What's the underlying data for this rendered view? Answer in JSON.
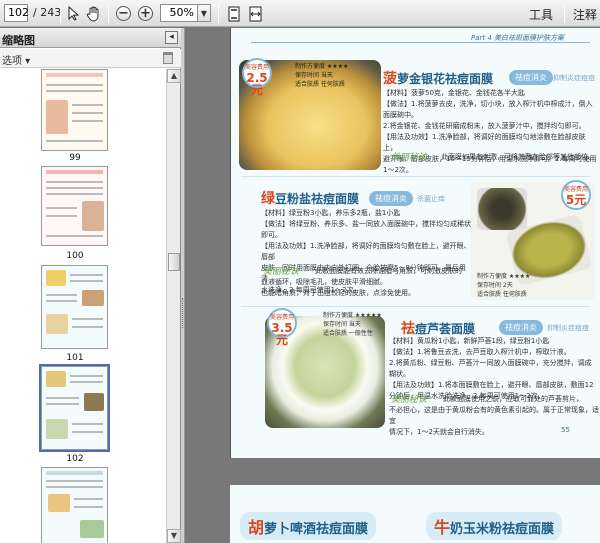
{
  "toolbar": {
    "page_current": "102",
    "page_total": "/ 243",
    "zoom": "50%",
    "tools_label": "工具",
    "comment_label": "注释",
    "icons": [
      "select-arrow-icon",
      "hand-icon",
      "zoom-out-icon",
      "zoom-in-icon",
      "fit-page-icon",
      "fit-width-icon"
    ]
  },
  "sidebar": {
    "title": "缩略图",
    "options_label": "选项 ▾",
    "thumbnails": [
      {
        "label": "99"
      },
      {
        "label": "100"
      },
      {
        "label": "101"
      },
      {
        "label": "102"
      }
    ]
  },
  "document": {
    "header": "Part 4 美白祛斑面膜护肤方案",
    "page_number": "55",
    "recipes": [
      {
        "price_label": "美容费用",
        "price": "2.5元",
        "specs": [
          "制作方便度 ★★★★",
          "保存时间 当天",
          "适合肤质 任何肤质"
        ],
        "title_lead": "菠",
        "title_rest": "萝金银花祛痘面膜",
        "badge": "祛痘消炎",
        "note": "抑制炎症痘痘",
        "lines": [
          "【材料】菠萝50克，金银花、金钱花各半大匙",
          "【做法】1.将菠萝去皮，洗净，切小块，放入榨汁机中榨成汁，倒入面膜碗中。",
          "2.将金银花、金钱花研磨成粉末，放入菠萝汁中，搅拌均匀即可。",
          "【用法及功效】1.洗净脸部，将调好的面膜均匀地涂敷在脸部皮肤上，",
          "避开眼、唇部皮肤，10～15分钟后，用温水洗净即可。2.每周可使用",
          "1～2次。"
        ],
        "sig": "美丽秘诀",
        "tip": "此面膜如果有刺激，可将其敷在脸部等其他部位。"
      },
      {
        "price_label": "美容费用",
        "price": "5元",
        "specs": [
          "制作方便度 ★★★★",
          "保存时间 2天",
          "适合肤质 任何肤质"
        ],
        "title_lead": "绿",
        "title_rest": "豆粉盐祛痘面膜",
        "badge": "祛痘消炎",
        "note": "杀菌止痒",
        "lines": [
          "【材料】绿豆粉3小匙，养乐多2瓶，盐1小匙",
          "【做法】将绿豆粉、养乐多、盐一同放入面膜碗中，搅拌均匀成稀状即可。",
          "【用法及功效】1.洗净脸部，将调好的面膜均匀敷在脸上，避开眼、唇部",
          "皮肤，同时用面膜由内向外打圈，全脸按摩5～8分钟即可，最后用清",
          "水洗净。2.每周可使用1～2次。",
          "此敷面膜能有效去除油脂与角质，可刺激皮肤的",
          "血液循环，吸除毛孔，使皮肤平滑细腻。",
          "也能暗角质，对于出痘较轻的皮肤，点涂免使用。"
        ],
        "sig": "美丽秘诀"
      },
      {
        "price_label": "美容费用",
        "price": "3.5元",
        "specs": [
          "制作方便度 ★★★★★",
          "保存时间 当天",
          "适合肤质 一般性性"
        ],
        "title_lead": "祛",
        "title_rest": "痘芦荟面膜",
        "badge": "祛痘消炎",
        "note": "抑制炎症痘痘",
        "lines": [
          "【材料】黄瓜粉1小匙，新鲜芦荟1段，绿豆粉1小匙",
          "【做法】1.将鲁豆去洗，去芦豆取入榨汁机中，榨取汁液。",
          "2.将黄瓜粉、绿豆粉、芦荟汁一同放入面膜碗中，充分搅拌，调成糊状。",
          "【用法及功效】1.将本面膜敷在脸上，避开眼、唇部皮肤，敷面12",
          "分钟后，用温水洗脸洗净，2.每周可使用1～2次。",
          "此款面膜使用之前，应取可靠处的芦荟剪片，",
          "不必担心，这是由于黄瓜粉会有的黄色素引起的。属于正常现象，适宜",
          "情况下，1～2天就会自行消失。"
        ],
        "sig": "美丽秘诀"
      }
    ],
    "next_page": {
      "left_lead": "胡",
      "left_rest": "萝卜啤酒祛痘面膜",
      "right_lead": "牛",
      "right_rest": "奶玉米粉祛痘面膜"
    }
  },
  "colors": {
    "accent": "#1f5f8a",
    "title_red": "#d84a1c",
    "page_bg": "#f3fbfd",
    "viewer_bg": "#787878"
  }
}
